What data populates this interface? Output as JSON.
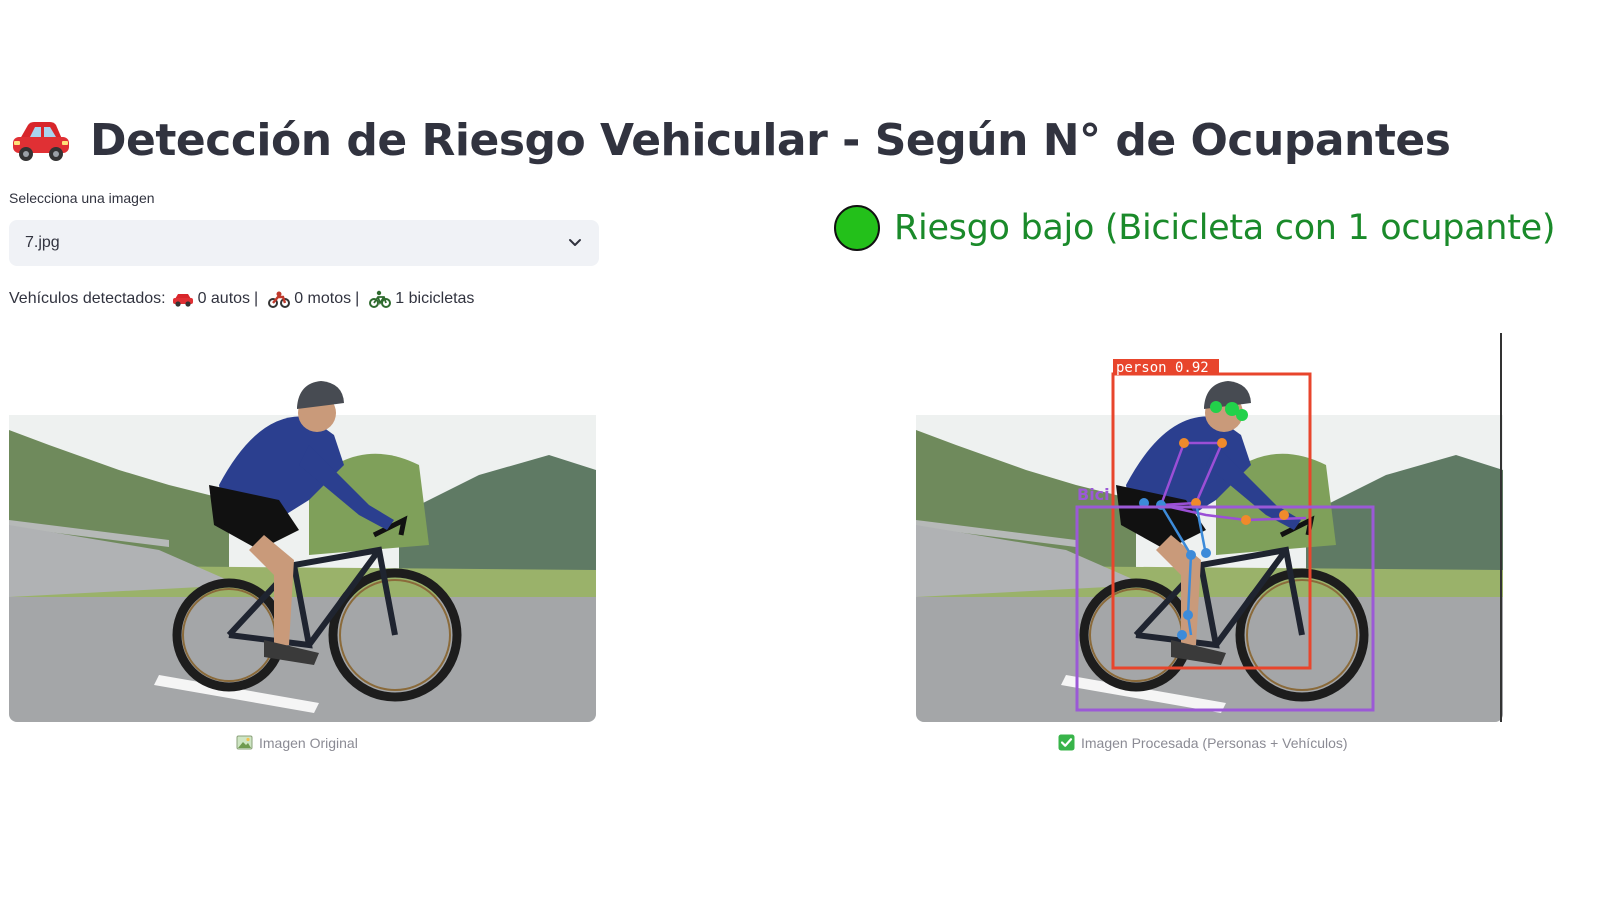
{
  "header": {
    "icon": "red-car-icon",
    "title": "Detección de Riesgo Vehicular - Según N° de Ocupantes"
  },
  "image_selector": {
    "label": "Selecciona una imagen",
    "selected_value": "7.jpg"
  },
  "vehicles": {
    "prefix": "Vehículos detectados:",
    "autos": "0 autos",
    "motos": "0 motos",
    "bicicletas": "1 bicicletas",
    "separator": "|"
  },
  "risk": {
    "indicator_color": "#23c01a",
    "text_color": "#1a8a2a",
    "text": "Riesgo bajo (Bicicleta con 1 ocupante)"
  },
  "original_image": {
    "caption": "Imagen Original",
    "caption_icon": "picture-icon"
  },
  "processed_image": {
    "caption": "Imagen Procesada (Personas + Vehículos)",
    "caption_icon": "check-mark-icon",
    "person_box_label": "person 0.92",
    "person_box_color": "#e8452c",
    "bicycle_box_label": "Bici",
    "bicycle_box_color": "#9b59d6"
  }
}
